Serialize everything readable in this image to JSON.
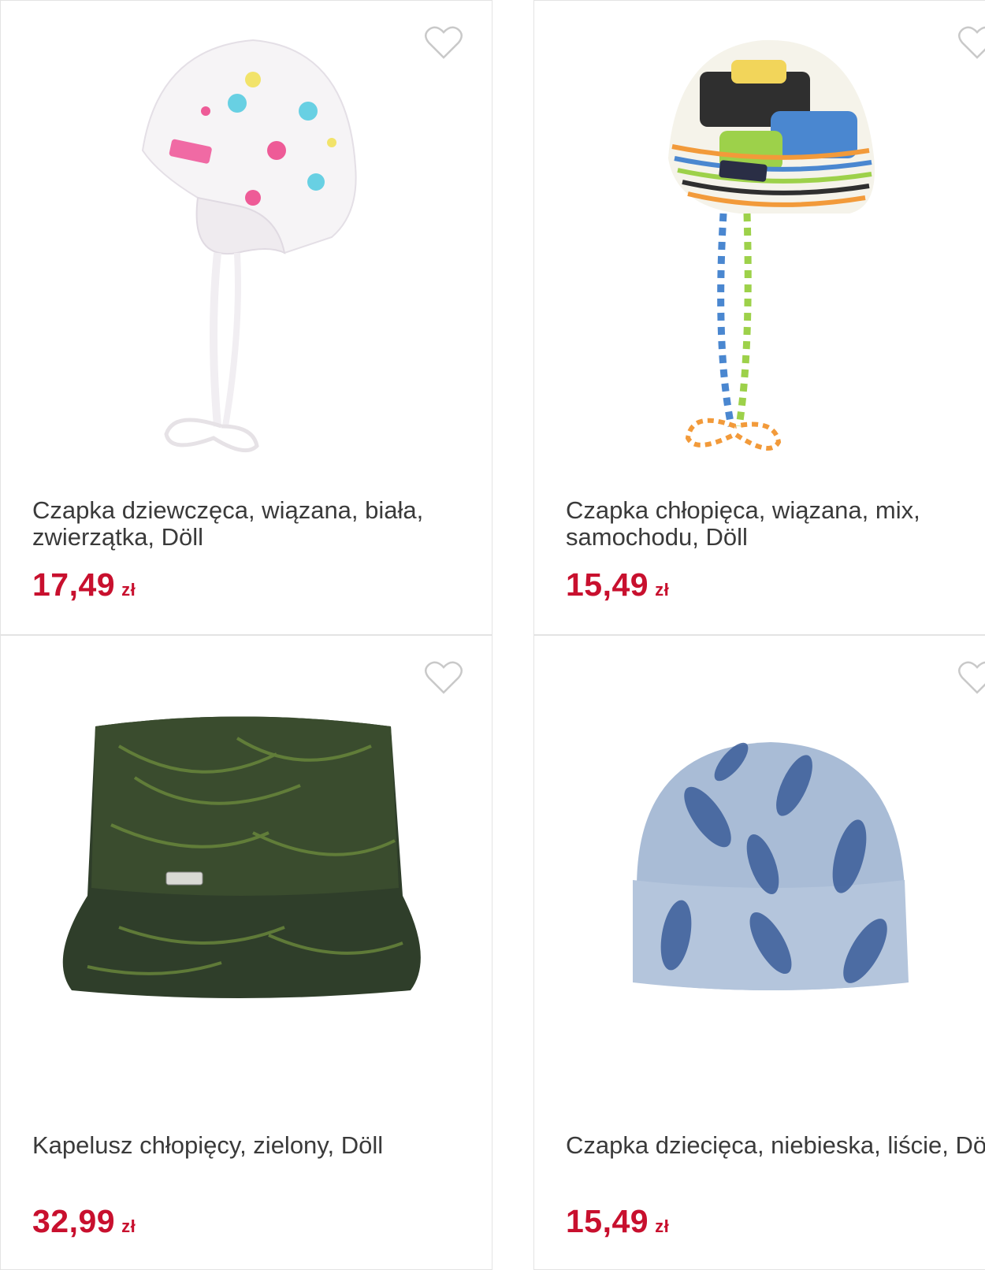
{
  "colors": {
    "price": "#c8102e",
    "title": "#3a3a3a",
    "heart_outline": "#c9c9c9"
  },
  "products": [
    {
      "title": "Czapka dziewczęca, wiązana, biała, zwierzątka, Döll",
      "price": "17,49",
      "currency": "zł",
      "favorite_icon": "heart-outline-icon",
      "image": "white-baby-bonnet-with-animal-print"
    },
    {
      "title": "Czapka chłopięca, wiązana, mix, samochodu, Döll",
      "price": "15,49",
      "currency": "zł",
      "favorite_icon": "heart-outline-icon",
      "image": "striped-baby-bonnet-with-cars-print"
    },
    {
      "title": "Kapelusz chłopięcy, zielony, Döll",
      "price": "32,99",
      "currency": "zł",
      "favorite_icon": "heart-outline-icon",
      "image": "green-palm-leaf-bucket-hat"
    },
    {
      "title": "Czapka dziecięca, niebieska, liście, Döll",
      "price": "15,49",
      "currency": "zł",
      "favorite_icon": "heart-outline-icon",
      "image": "blue-leaf-beanie"
    }
  ]
}
